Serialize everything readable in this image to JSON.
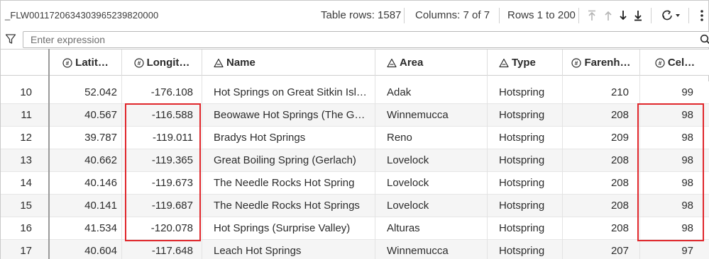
{
  "toolbar": {
    "table_name": "_FLW001172063430396523982000​0",
    "table_rows": "Table rows: 1587",
    "columns": "Columns: 7 of 7",
    "rows_range": "Rows 1 to 200"
  },
  "filter": {
    "placeholder": "Enter expression"
  },
  "columns": [
    {
      "label": "Latit…",
      "type": "numeric"
    },
    {
      "label": "Longit…",
      "type": "numeric"
    },
    {
      "label": "Name",
      "type": "string"
    },
    {
      "label": "Area",
      "type": "string"
    },
    {
      "label": "Type",
      "type": "string"
    },
    {
      "label": "Farenh…",
      "type": "numeric"
    },
    {
      "label": "Cel…",
      "type": "numeric"
    }
  ],
  "rows": [
    {
      "num": "10",
      "lat": "52.042",
      "lon": "-176.108",
      "name": "Hot Springs on Great Sitkin Isl…",
      "area": "Adak",
      "type": "Hotspring",
      "f": "210",
      "c": "99"
    },
    {
      "num": "11",
      "lat": "40.567",
      "lon": "-116.588",
      "name": "Beowawe Hot Springs (The G…",
      "area": "Winnemucca",
      "type": "Hotspring",
      "f": "208",
      "c": "98"
    },
    {
      "num": "12",
      "lat": "39.787",
      "lon": "-119.011",
      "name": "Bradys Hot Springs",
      "area": "Reno",
      "type": "Hotspring",
      "f": "209",
      "c": "98"
    },
    {
      "num": "13",
      "lat": "40.662",
      "lon": "-119.365",
      "name": "Great Boiling Spring (Gerlach)",
      "area": "Lovelock",
      "type": "Hotspring",
      "f": "208",
      "c": "98"
    },
    {
      "num": "14",
      "lat": "40.146",
      "lon": "-119.673",
      "name": "The Needle Rocks Hot Spring",
      "area": "Lovelock",
      "type": "Hotspring",
      "f": "208",
      "c": "98"
    },
    {
      "num": "15",
      "lat": "40.141",
      "lon": "-119.687",
      "name": "The Needle Rocks Hot Springs",
      "area": "Lovelock",
      "type": "Hotspring",
      "f": "208",
      "c": "98"
    },
    {
      "num": "16",
      "lat": "41.534",
      "lon": "-120.078",
      "name": "Hot Springs (Surprise Valley)",
      "area": "Alturas",
      "type": "Hotspring",
      "f": "208",
      "c": "98"
    },
    {
      "num": "17",
      "lat": "40.604",
      "lon": "-117.648",
      "name": "Leach Hot Springs",
      "area": "Winnemucca",
      "type": "Hotspring",
      "f": "207",
      "c": "97"
    }
  ],
  "colors": {
    "highlight": "#e0262b",
    "row_alt": "#f5f5f5",
    "border": "#cfcfcf"
  },
  "icons": {
    "numeric_column": "numeric-type-icon",
    "string_column": "string-type-icon",
    "filter": "filter-icon",
    "search": "search-icon",
    "refresh": "refresh-icon",
    "more": "more-vertical-icon"
  }
}
